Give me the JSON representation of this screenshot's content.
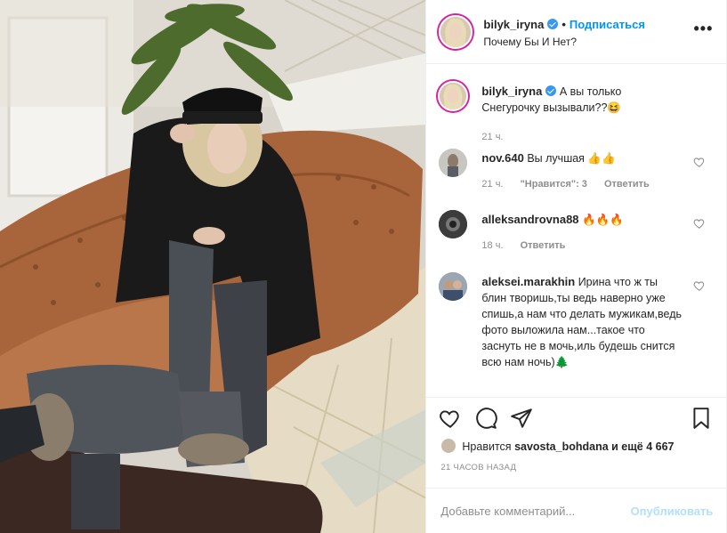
{
  "header": {
    "username": "bilyk_iryna",
    "separator": "•",
    "follow_label": "Подписаться",
    "location": "Почему Бы И Нет?",
    "more_label": "•••"
  },
  "caption": {
    "username": "bilyk_iryna",
    "text": "А вы только Снегурочку вызывали??😆",
    "time": "21 ч."
  },
  "comments": [
    {
      "username": "nov.640",
      "text": "Вы лучшая 👍👍",
      "time": "21 ч.",
      "likes": "\"Нравится\": 3",
      "reply": "Ответить"
    },
    {
      "username": "alleksandrovna88",
      "text": "🔥🔥🔥",
      "time": "18 ч.",
      "reply": "Ответить"
    },
    {
      "username": "aleksei.marakhin",
      "text": "Ирина что ж ты блин творишь,ты ведь наверно уже спишь,а нам что делать мужикам,ведь фото выложила нам...такое что заснуть не в мочь,иль будешь снится всю нам ночь)🌲"
    }
  ],
  "likes": {
    "prefix": "Нравится",
    "user": "savosta_bohdana",
    "suffix": "и ещё 4 667"
  },
  "time_ago": "21 часов назад",
  "comment_input": {
    "placeholder": "Добавьте комментарий...",
    "publish_label": "Опубликовать"
  },
  "colors": {
    "accent": "#0095f6",
    "publish_disabled": "#b2dffc",
    "sofa": "#a8643a",
    "coat": "#1a1a1a"
  }
}
